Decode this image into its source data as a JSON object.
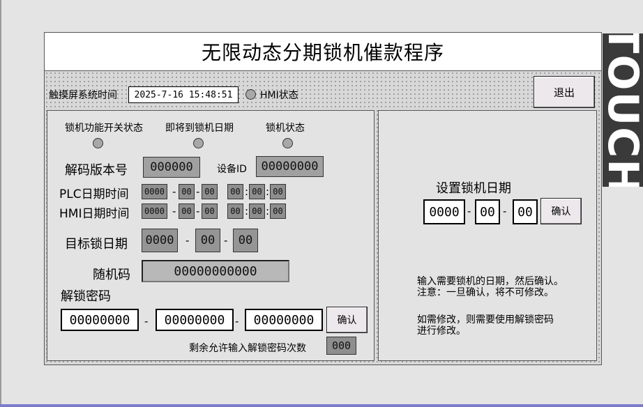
{
  "title": "无限动态分期锁机催款程序",
  "brand_strip": "TOUCH",
  "header": {
    "time_label": "触摸屏系统时间",
    "time_value": "2025-7-16 15:48:51",
    "hmi_status_label": "HMI状态",
    "exit_button": "退出"
  },
  "left": {
    "status_labels": [
      "锁机功能开关状态",
      "即将到锁机日期",
      "锁机状态"
    ],
    "decode_version_label": "解码版本号",
    "decode_version_value": "000000",
    "device_id_label": "设备ID",
    "device_id_value": "00000000",
    "plc_label": "PLC日期时间",
    "plc": [
      "0000",
      "00",
      "00",
      "00",
      "00",
      "00"
    ],
    "hmi_label": "HMI日期时间",
    "hmi": [
      "0000",
      "00",
      "00",
      "00",
      "00",
      "00"
    ],
    "target_label": "目标锁日期",
    "target": [
      "0000",
      "00",
      "00"
    ],
    "random_label": "随机码",
    "random_value": "00000000000",
    "unlock_label": "解锁密码",
    "unlock": [
      "00000000",
      "00000000",
      "00000000"
    ],
    "confirm_button": "确认",
    "remaining_label": "剩余允许输入解锁密码次数",
    "remaining_value": "000"
  },
  "right": {
    "set_date_label": "设置锁机日期",
    "date": [
      "0000",
      "00",
      "00"
    ],
    "confirm_button": "确认",
    "note1_line1": "输入需要锁机的日期，然后确认。",
    "note1_line2": "注意：一旦确认，将不可修改。",
    "note2_line1": "如需修改，则需要使用解锁密码",
    "note2_line2": "进行修改。"
  },
  "separators": {
    "dash": "-",
    "colon": ":"
  }
}
